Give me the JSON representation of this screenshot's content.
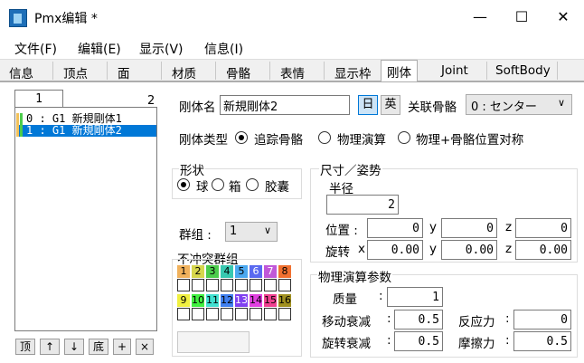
{
  "window": {
    "title": "Pmx编辑 *"
  },
  "menu": [
    "文件(F)",
    "编辑(E)",
    "显示(V)",
    "信息(I)"
  ],
  "tabs": [
    "信息",
    "顶点",
    "面",
    "材质",
    "骨骼",
    "表情",
    "显示枠",
    "刚体",
    "Joint",
    "SoftBody"
  ],
  "list": {
    "index": "1",
    "count": "2",
    "items": [
      "0 : G1   新規剛体1",
      "1 : G1   新規剛体2"
    ],
    "buttons": [
      "顶",
      "↑",
      "↓",
      "底",
      "+",
      "×"
    ]
  },
  "rigid": {
    "name_label": "刚体名",
    "name_value": "新規剛体2",
    "lang_ja": "日",
    "lang_en": "英",
    "bone_label": "关联骨骼",
    "bone_value": "0 : センター",
    "type_label": "刚体类型",
    "types": [
      "追踪骨骼",
      "物理演算",
      "物理+骨骼位置对称"
    ],
    "shape_title": "形状",
    "shapes": [
      "球",
      "箱",
      "胶囊"
    ],
    "group_label": "群组 :",
    "group_value": "1",
    "nocollide_title": "不冲突群组",
    "nocollide_row1": [
      "1",
      "2",
      "3",
      "4",
      "5",
      "6",
      "7",
      "8"
    ],
    "nocollide_row2": [
      "9",
      "10",
      "11",
      "12",
      "13",
      "14",
      "15",
      "16"
    ],
    "colors1": [
      "#f0b15c",
      "#d6d64d",
      "#4ccc4c",
      "#38c8b0",
      "#4ca8f0",
      "#5a6af0",
      "#c058d8",
      "#f07030"
    ],
    "colors2": [
      "#f0f040",
      "#40f040",
      "#40e0d0",
      "#4080f0",
      "#8040f0",
      "#e040e0",
      "#f04090",
      "#a09020"
    ],
    "size_title": "尺寸／姿势",
    "radius_label": "半径",
    "radius_value": "2",
    "pos_label": "位置 :",
    "pos": [
      "0",
      "0",
      "0"
    ],
    "rot_label": "旋转",
    "rot": [
      "0.00",
      "0.00",
      "0.00"
    ],
    "physics_title": "物理演算参数",
    "mass_label": "质量",
    "mass_value": "1",
    "lindamp_label": "移动衰减",
    "lindamp_value": "0.5",
    "rotdamp_label": "旋转衰减",
    "rotdamp_value": "0.5",
    "restitution_label": "反应力",
    "restitution_value": "0",
    "friction_label": "摩擦力",
    "friction_value": "0.5"
  }
}
